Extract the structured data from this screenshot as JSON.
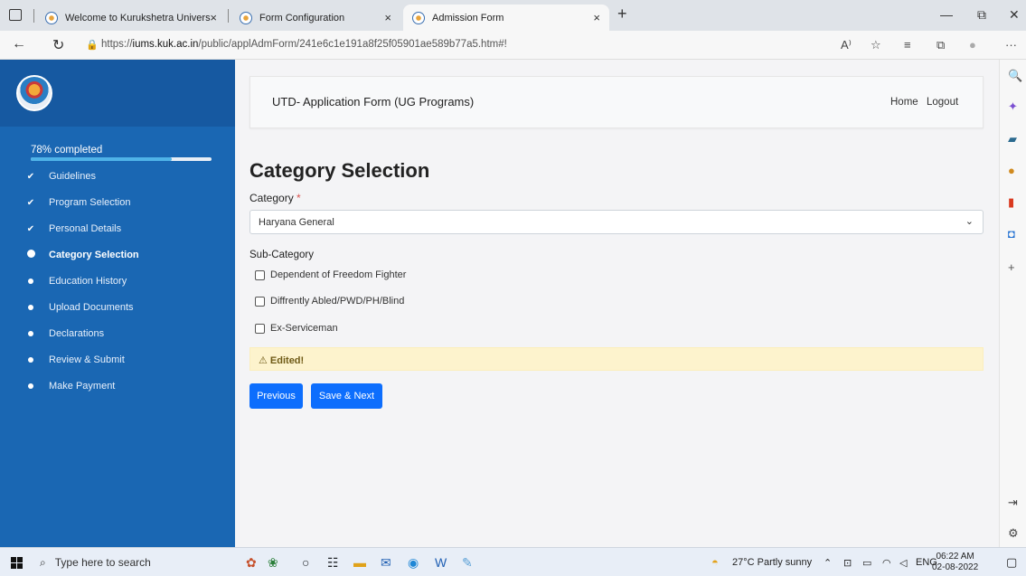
{
  "browser": {
    "tabs": [
      {
        "title": "Welcome to Kurukshetra Univers",
        "close": "×"
      },
      {
        "title": "Form Configuration",
        "close": "×"
      },
      {
        "title": "Admission Form",
        "close": "×"
      }
    ],
    "new_tab": "+",
    "window_controls": {
      "minimize": "—",
      "restore": "⧉",
      "close": "✕"
    },
    "url_prefix": "https://",
    "url_host": "iums.kuk.ac.in",
    "url_path": "/public/applAdmForm/241e6c1e191a8f25f05901ae589b77a5.htm#!",
    "nav": {
      "back": "←",
      "refresh": "↻"
    },
    "toolbar_icons": {
      "read_aloud": "A⁾",
      "favorite": "☆",
      "favorites_list": "≡",
      "collections": "⧉",
      "profile": "●",
      "more": "···"
    }
  },
  "sidebar": {
    "progress_text": "78% completed",
    "progress_value": 0.78,
    "steps": [
      {
        "label": "Guidelines",
        "state": "done"
      },
      {
        "label": "Program Selection",
        "state": "done"
      },
      {
        "label": "Personal Details",
        "state": "done"
      },
      {
        "label": "Category Selection",
        "state": "current"
      },
      {
        "label": "Education History",
        "state": "pending"
      },
      {
        "label": "Upload Documents",
        "state": "pending"
      },
      {
        "label": "Declarations",
        "state": "pending"
      },
      {
        "label": "Review & Submit",
        "state": "pending"
      },
      {
        "label": "Make Payment",
        "state": "pending"
      }
    ]
  },
  "header": {
    "title": "UTD- Application Form (UG Programs)",
    "home": "Home",
    "logout": "Logout"
  },
  "form": {
    "section_title": "Category Selection",
    "category_label": "Category",
    "required_mark": "*",
    "category_value": "Haryana General",
    "subcategory_label": "Sub-Category",
    "subcategories": [
      {
        "label": "Dependent of Freedom Fighter",
        "checked": false
      },
      {
        "label": "Diffrently Abled/PWD/PH/Blind",
        "checked": false
      },
      {
        "label": "Ex-Serviceman",
        "checked": false
      }
    ],
    "alert": "⚠ Edited!",
    "previous_button": "Previous",
    "save_next_button": "Save & Next"
  },
  "taskbar": {
    "search_placeholder": "Type here to search",
    "weather": "27°C  Partly sunny",
    "language": "ENG",
    "time": "06:22 AM",
    "date": "02-08-2022"
  },
  "colors": {
    "sidebar": "#1a67b3",
    "primary_button": "#0d6efd",
    "alert_bg": "#fdf3cd"
  }
}
